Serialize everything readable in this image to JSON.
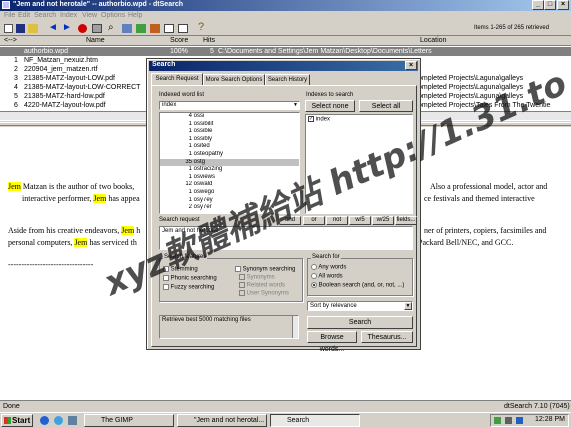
{
  "app": {
    "title": "\"Jem and not herotale\" -- authorbio.wpd - dtSearch",
    "menu": [
      "File",
      "Edit",
      "Search",
      "Index",
      "View",
      "Options",
      "Help"
    ],
    "items_label": "Items 1-265 of 265 retrieved"
  },
  "results": {
    "headers": {
      "name": "Name",
      "score": "Score",
      "hits": "Hits",
      "location": "Location"
    },
    "rows": [
      {
        "num": "",
        "name": "authorbio.wpd",
        "score": "100%",
        "hits": "5",
        "location": "C:\\Documents and Settings\\Jem Matzan\\Desktop\\Documents\\Letters"
      },
      {
        "num": "1",
        "name": "NF_Matzan_nexuiz.htm",
        "score": "",
        "hits": "",
        "location": ""
      },
      {
        "num": "2",
        "name": "220904_jem_matzen.rtf",
        "score": "",
        "hits": "",
        "location": ""
      },
      {
        "num": "3",
        "name": "21385-MATZ-layout-LOW.pdf",
        "score": "",
        "hits": "",
        "location": "ompleted Projects\\Laguna\\galleys"
      },
      {
        "num": "4",
        "name": "21385-MATZ-layout-LOW-CORRECT",
        "score": "",
        "hits": "",
        "location": "ompleted Projects\\Laguna\\galleys"
      },
      {
        "num": "5",
        "name": "21385-MATZ-hard-low.pdf",
        "score": "",
        "hits": "",
        "location": "ompleted Projects\\Laguna\\galleys"
      },
      {
        "num": "6",
        "name": "4220-MATZ-layout-low.pdf",
        "score": "",
        "hits": "",
        "location": "ompleted Projects\\Tales From The Twentie"
      }
    ]
  },
  "document": {
    "p1a": "Jem",
    "p1b": " Matzan is the author of two books,",
    "p1c": " Also a professional model, actor and",
    "p1d": "interactive performer, ",
    "p1e": "Jem",
    "p1f": " has appea",
    "p1g": "ce festivals and themed interactive",
    "p2a": "Aside from his creative endeavors, ",
    "p2b": "Jem",
    "p2c": " h",
    "p2d": "ner of printers, copiers, facsimiles and",
    "p2e": "personal computers, ",
    "p2f": "Jem",
    "p2g": " has serviced th",
    "p2h": "Packard Bell/NEC, and GCC.",
    "rule": "--------------------------------"
  },
  "dialog": {
    "title": "Search",
    "tabs": [
      "Search Request",
      "More Search Options",
      "Search History"
    ],
    "indexed_label": "Indexed word list",
    "word_input": "index",
    "words": [
      {
        "count": "4",
        "word": "ossi"
      },
      {
        "count": "1",
        "word": "ossibilit"
      },
      {
        "count": "1",
        "word": "ossible"
      },
      {
        "count": "1",
        "word": "ossibly"
      },
      {
        "count": "1",
        "word": "osited"
      },
      {
        "count": "1",
        "word": "osteopathy"
      },
      {
        "count": "35",
        "word": "ostg"
      },
      {
        "count": "1",
        "word": "ostracizing"
      },
      {
        "count": "1",
        "word": "osviews"
      },
      {
        "count": "12",
        "word": "oswald"
      },
      {
        "count": "1",
        "word": "oswego"
      },
      {
        "count": "1",
        "word": "osy7ey"
      },
      {
        "count": "2",
        "word": "osy7er"
      }
    ],
    "selected_word": "ostg",
    "indexes_label": "Indexes to search",
    "select_none": "Select none",
    "select_all": "Select all",
    "index_item": "index",
    "ops": [
      "and",
      "or",
      "not",
      "w/5",
      "w/25",
      "fields..."
    ],
    "request_label": "Search request",
    "request_value": "Jem and not herotale",
    "features_label": "Search features",
    "feature_checks": [
      "Stemming",
      "Phonic searching",
      "Fuzzy searching"
    ],
    "synonym_checks": [
      "Synonym searching",
      "Synonyms",
      "Related words",
      "User Synonyms"
    ],
    "search_for_label": "Search for",
    "radios": [
      "Any words",
      "All words",
      "Boolean search (and, or, not, ...)"
    ],
    "sort_value": "Sort by relevance",
    "limit_text": "Retrieve best 5000 matching files",
    "search_btn": "Search",
    "browse_btn": "Browse words...",
    "thesaurus_btn": "Thesaurus..."
  },
  "statusbar": {
    "left": "Done",
    "right": "dtSearch 7.10 (7045)"
  },
  "taskbar": {
    "start": "Start",
    "tasks": [
      "The GIMP",
      "\"Jem and not herotal...",
      "Search"
    ],
    "clock": "12:28 PM"
  },
  "watermark": "xyz軟體補給站 http://1.31.to"
}
